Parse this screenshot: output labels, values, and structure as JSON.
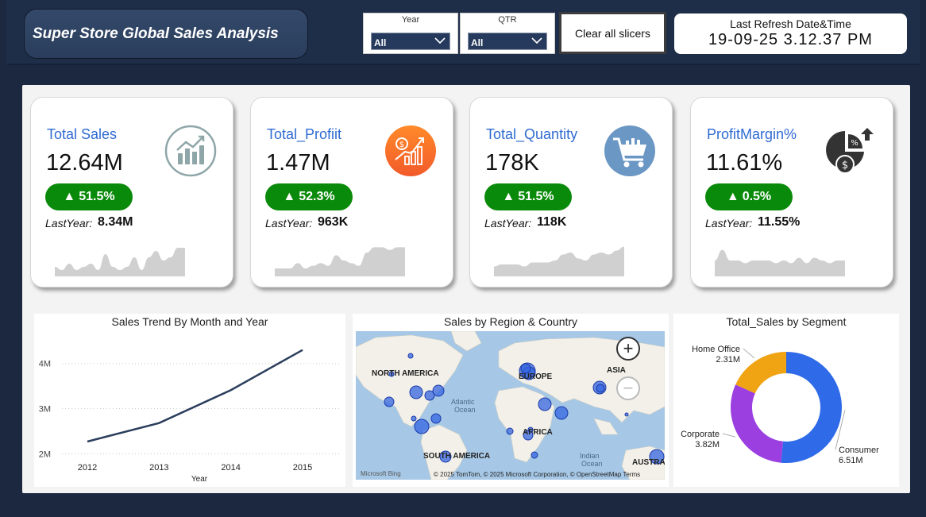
{
  "header": {
    "title": "Super Store Global Sales Analysis",
    "slicers": [
      {
        "label": "Year",
        "value": "All"
      },
      {
        "label": "QTR",
        "value": "All"
      }
    ],
    "clear_button": "Clear all slicers",
    "refresh_label": "Last Refresh Date&Time",
    "refresh_value": "19-09-25 3.12.37 PM"
  },
  "kpis": [
    {
      "title": "Total Sales",
      "value": "12.64M",
      "change": "51.5%",
      "ly_label": "LastYear:",
      "ly_value": "8.34M",
      "icon": "growth-chart-icon",
      "trend": [
        3,
        2,
        4,
        2,
        3,
        4,
        2,
        7,
        3,
        2,
        3,
        6,
        2,
        6,
        8,
        5,
        6,
        9,
        9
      ],
      "trend_range": [
        0,
        10
      ]
    },
    {
      "title": "Total_Profiit",
      "value": "1.47M",
      "change": "52.3%",
      "ly_label": "LastYear:",
      "ly_value": "963K",
      "icon": "dollar-growth-icon",
      "trend": [
        3,
        3,
        3,
        5,
        3,
        4,
        5,
        4,
        8,
        6,
        5,
        4,
        9,
        11,
        11,
        10,
        11,
        11
      ],
      "trend_range": [
        0,
        12
      ]
    },
    {
      "title": "Total_Quantity",
      "value": "178K",
      "change": "51.5%",
      "ly_label": "LastYear:",
      "ly_value": "118K",
      "icon": "cart-icon",
      "trend": [
        5,
        6,
        6,
        6,
        5,
        7,
        7,
        7,
        8,
        11,
        12,
        9,
        8,
        11,
        12,
        11,
        13,
        15
      ],
      "trend_range": [
        0,
        16
      ]
    },
    {
      "title": "ProfitMargin%",
      "value": "11.61%",
      "change": "0.5%",
      "ly_label": "LastYear:",
      "ly_value": "11.55%",
      "icon": "pie-percent-icon",
      "trend": [
        6,
        10,
        6,
        6,
        5,
        6,
        6,
        6,
        5,
        6,
        5,
        7,
        5,
        7,
        6,
        5,
        6,
        6
      ],
      "trend_range": [
        0,
        12
      ]
    }
  ],
  "charts": {
    "trend_title": "Sales Trend By Month and Year",
    "map_title": "Sales by Region & Country",
    "donut_title": "Total_Sales by Segment",
    "map_labels": {
      "na": "NORTH AMERICA",
      "eu": "EUROPE",
      "asia": "ASIA",
      "af": "AFRICA",
      "sa": "SOUTH AMERICA",
      "au": "AUSTRA",
      "ocean": "Atlantic",
      "ocean2": "Ocean",
      "io": "Indian",
      "io2": "Ocean"
    },
    "map_attr": "© 2025 TomTom, © 2025 Microsoft Corporation, © OpenStreetMap  Terms",
    "map_logo": "Microsoft Bing"
  },
  "chart_data": [
    {
      "type": "line",
      "title": "Sales Trend By Month and Year",
      "xlabel": "Year",
      "ylabel": "",
      "x": [
        "2012",
        "2013",
        "2014",
        "2015"
      ],
      "series": [
        {
          "values": [
            2.27,
            2.68,
            3.41,
            4.3
          ]
        }
      ],
      "ylim": [
        1.9,
        4.4
      ],
      "yticks": [
        2,
        3,
        4
      ],
      "ytick_labels": [
        "2M",
        "3M",
        "4M"
      ],
      "grid": true
    },
    {
      "type": "pie",
      "title": "Total_Sales by Segment",
      "categories": [
        "Consumer",
        "Corporate",
        "Home Office"
      ],
      "values": [
        6.51,
        3.82,
        2.31
      ],
      "labels": [
        "6.51M",
        "3.82M",
        "2.31M"
      ],
      "colors": [
        "#2f6ae8",
        "#9b3fe0",
        "#f0a313"
      ]
    }
  ],
  "colors": {
    "accent": "#2f6bd1",
    "badge": "#0a8a0a",
    "line": "#2b3e5c"
  }
}
